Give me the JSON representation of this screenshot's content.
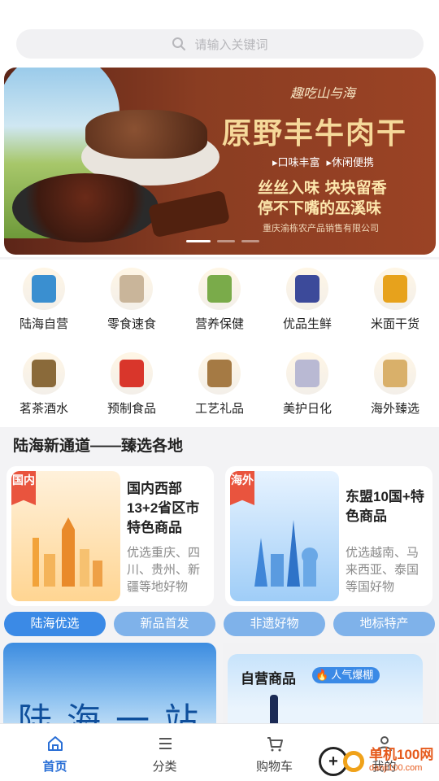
{
  "search": {
    "placeholder": "请输入关键词"
  },
  "banner": {
    "brand": "趣吃山与海",
    "title": "原野丰牛肉干",
    "tags": [
      "▸口味丰富",
      "▸休闲便携"
    ],
    "slogan_line1": "丝丝入味 块块留香",
    "slogan_line2": "停不下嘴的巫溪味",
    "company": "重庆渝栋农产品销售有限公司",
    "slides_total": 3,
    "active_slide": 1
  },
  "categories": [
    {
      "label": "陆海自营",
      "icon": "selfown-icon",
      "color": "#3a8fd0"
    },
    {
      "label": "零食速食",
      "icon": "snack-icon",
      "color": "#c9b59a"
    },
    {
      "label": "营养保健",
      "icon": "health-icon",
      "color": "#7aab4a"
    },
    {
      "label": "优品生鲜",
      "icon": "grape-icon",
      "color": "#3c4a9a"
    },
    {
      "label": "米面干货",
      "icon": "oil-icon",
      "color": "#e7a21c"
    },
    {
      "label": "茗茶酒水",
      "icon": "tea-icon",
      "color": "#8a6a3a"
    },
    {
      "label": "预制食品",
      "icon": "prepared-food-icon",
      "color": "#d9362b"
    },
    {
      "label": "工艺礼品",
      "icon": "craft-icon",
      "color": "#a57a44"
    },
    {
      "label": "美护日化",
      "icon": "cosmetics-icon",
      "color": "#b9b9d3"
    },
    {
      "label": "海外臻选",
      "icon": "overseas-icon",
      "color": "#d9b06a"
    }
  ],
  "section": {
    "title": "陆海新通道——臻选各地"
  },
  "region_cards": [
    {
      "flag": "国内",
      "title": "国内西部13+2省区市特色商品",
      "desc": "优选重庆、四川、贵州、新疆等地好物"
    },
    {
      "flag": "海外",
      "title": "东盟10国+特色商品",
      "desc": "优选越南、马来西亚、泰国等国好物"
    }
  ],
  "tabs": [
    "陆海优选",
    "新品首发",
    "非遗好物",
    "地标特产"
  ],
  "active_tab": 0,
  "promo_left": {
    "text": "陆海一站"
  },
  "promo_right": {
    "title": "自营商品",
    "badge": "人气爆棚"
  },
  "nav": [
    {
      "label": "首页",
      "icon": "home-icon",
      "active": true
    },
    {
      "label": "分类",
      "icon": "list-icon",
      "active": false
    },
    {
      "label": "购物车",
      "icon": "cart-icon",
      "active": false
    },
    {
      "label": "我的",
      "icon": "user-icon",
      "active": false
    }
  ],
  "watermark": {
    "line1": "单机100网",
    "line2": "danji100.com"
  },
  "colors": {
    "accent": "#3b8ae6",
    "nav_active": "#2a6fd6",
    "flag": "#e9543e"
  }
}
